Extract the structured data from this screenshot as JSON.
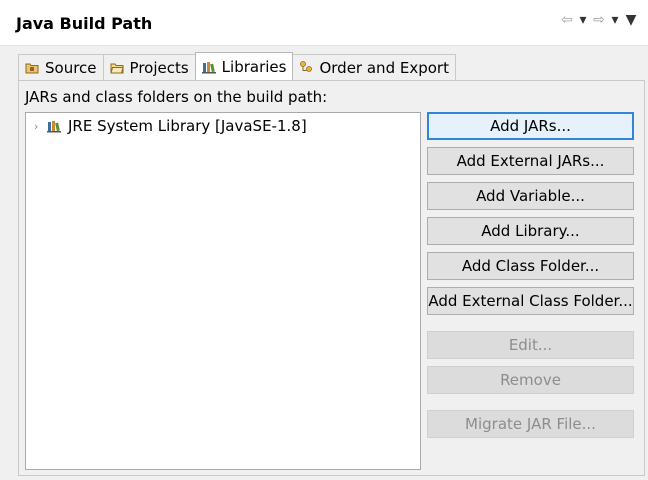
{
  "header": {
    "title": "Java Build Path"
  },
  "nav": {
    "back": "⇦",
    "back_menu": "▾",
    "forward": "⇨",
    "forward_menu": "▾",
    "view_menu": "▼"
  },
  "tabs": [
    {
      "label": "Source"
    },
    {
      "label": "Projects"
    },
    {
      "label": "Libraries"
    },
    {
      "label": "Order and Export"
    }
  ],
  "panel": {
    "label": "JARs and class folders on the build path:"
  },
  "tree": {
    "items": [
      {
        "label": "JRE System Library [JavaSE-1.8]"
      }
    ]
  },
  "buttons": {
    "add_jars": "Add JARs...",
    "add_external_jars": "Add External JARs...",
    "add_variable": "Add Variable...",
    "add_library": "Add Library...",
    "add_class_folder": "Add Class Folder...",
    "add_external_class_folder": "Add External Class Folder...",
    "edit": "Edit...",
    "remove": "Remove",
    "migrate_jar": "Migrate JAR File..."
  }
}
